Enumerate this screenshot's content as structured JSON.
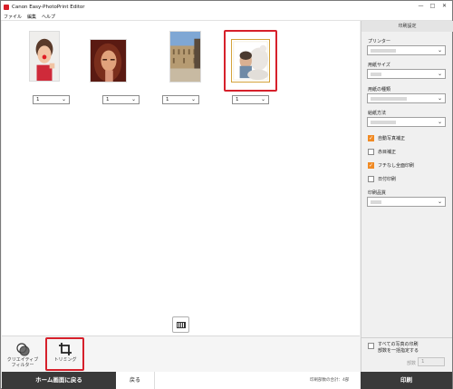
{
  "window": {
    "title": "Canon Easy-PhotoPrint Editor",
    "controls": [
      "—",
      "□",
      "✕"
    ]
  },
  "menu": [
    "ファイル",
    "編集",
    "ヘルプ"
  ],
  "photos": [
    {
      "copies": "1",
      "selected": false
    },
    {
      "copies": "1",
      "selected": false
    },
    {
      "copies": "1",
      "selected": false
    },
    {
      "copies": "1",
      "selected": true
    }
  ],
  "settings": {
    "header": "印刷設定",
    "printer_label": "プリンター",
    "paper_size_label": "用紙サイズ",
    "media_type_label": "用紙の種類",
    "paper_source_label": "給紙方法",
    "auto_correct_label": "自動写真補正",
    "auto_correct_checked": true,
    "red_eye_label": "赤目補正",
    "red_eye_checked": false,
    "borderless_label": "フチなし全面印刷",
    "borderless_checked": true,
    "date_print_label": "日付印刷",
    "date_print_checked": false,
    "quality_label": "印刷品質"
  },
  "bottom_panel": {
    "all_same_line1": "すべての写真の印刷",
    "all_same_line2": "部数を一括指定する",
    "copies_label": "部数",
    "copies_value": "1"
  },
  "tools": {
    "creative_filter_label_1": "クリエイティブ",
    "creative_filter_label_2": "フィルター",
    "trimming_label": "トリミング"
  },
  "footer": {
    "home_label": "ホーム画面に戻る",
    "back_label": "戻る",
    "total_label": "印刷部数の合計：4部",
    "print_label": "印刷"
  },
  "colors": {
    "accent_red": "#d6202b",
    "checkbox_orange": "#f08a24",
    "dark_button": "#3a3a3a"
  }
}
